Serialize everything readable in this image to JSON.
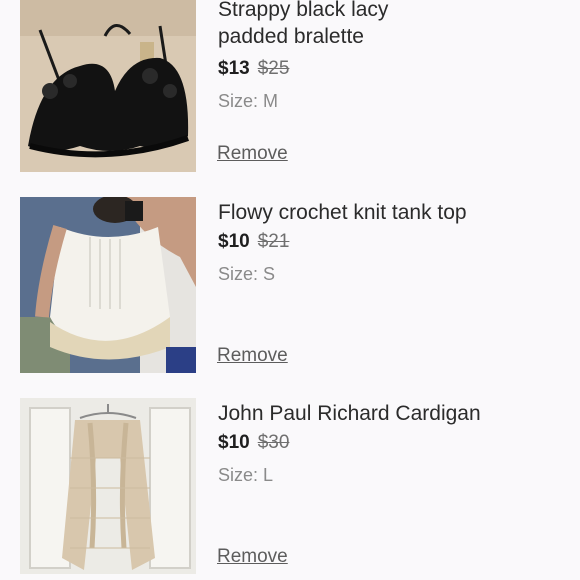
{
  "items": [
    {
      "title": "Strappy black lacy\npadded bralette",
      "price": "$13",
      "original_price": "$25",
      "size": "Size: M",
      "remove_label": "Remove"
    },
    {
      "title": "Flowy crochet knit tank top",
      "price": "$10",
      "original_price": "$21",
      "size": "Size: S",
      "remove_label": "Remove"
    },
    {
      "title": "John Paul Richard Cardigan",
      "price": "$10",
      "original_price": "$30",
      "size": "Size: L",
      "remove_label": "Remove"
    }
  ]
}
